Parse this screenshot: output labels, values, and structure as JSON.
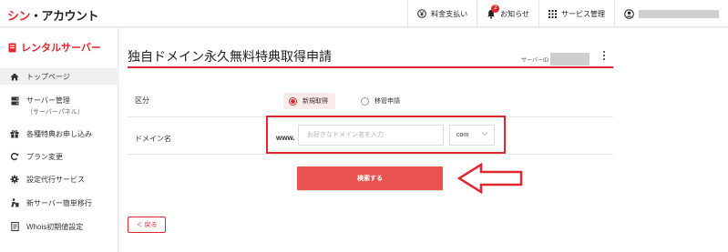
{
  "header": {
    "logo_accent": "シン",
    "logo_rest": "・アカウント",
    "nav": {
      "billing": "料金支払い",
      "notices": "お知らせ",
      "notice_count": "2",
      "services": "サービス管理"
    }
  },
  "sidebar": {
    "title": "レンタルサーバー",
    "items": [
      {
        "label": "トップページ",
        "sub": "",
        "icon": "home-icon"
      },
      {
        "label": "サーバー管理",
        "sub": "（サーバーパネル）",
        "icon": "server-icon"
      },
      {
        "label": "各種特典お申し込み",
        "sub": "",
        "icon": "gift-icon"
      },
      {
        "label": "プラン変更",
        "sub": "",
        "icon": "refresh-icon"
      },
      {
        "label": "設定代行サービス",
        "sub": "",
        "icon": "gear-icon"
      },
      {
        "label": "新サーバー簡単移行",
        "sub": "",
        "icon": "mover-icon"
      },
      {
        "label": "Whois初期値設定",
        "sub": "",
        "icon": "document-icon"
      }
    ]
  },
  "main": {
    "title": "独自ドメイン永久無料特典取得申請",
    "server_id_label": "サーバーID",
    "form": {
      "type_label": "区分",
      "options": [
        {
          "label": "新規取得",
          "selected": true
        },
        {
          "label": "移管申請",
          "selected": false
        }
      ],
      "domain_label": "ドメイン名",
      "www_prefix": "www.",
      "domain_placeholder": "お好きなドメイン名を入力",
      "domain_value": "",
      "tld_selected": "com"
    },
    "search_button": "検索する",
    "back_button": "＜ 戻る"
  },
  "colors": {
    "accent": "#e0262f",
    "button": "#e8534f"
  }
}
